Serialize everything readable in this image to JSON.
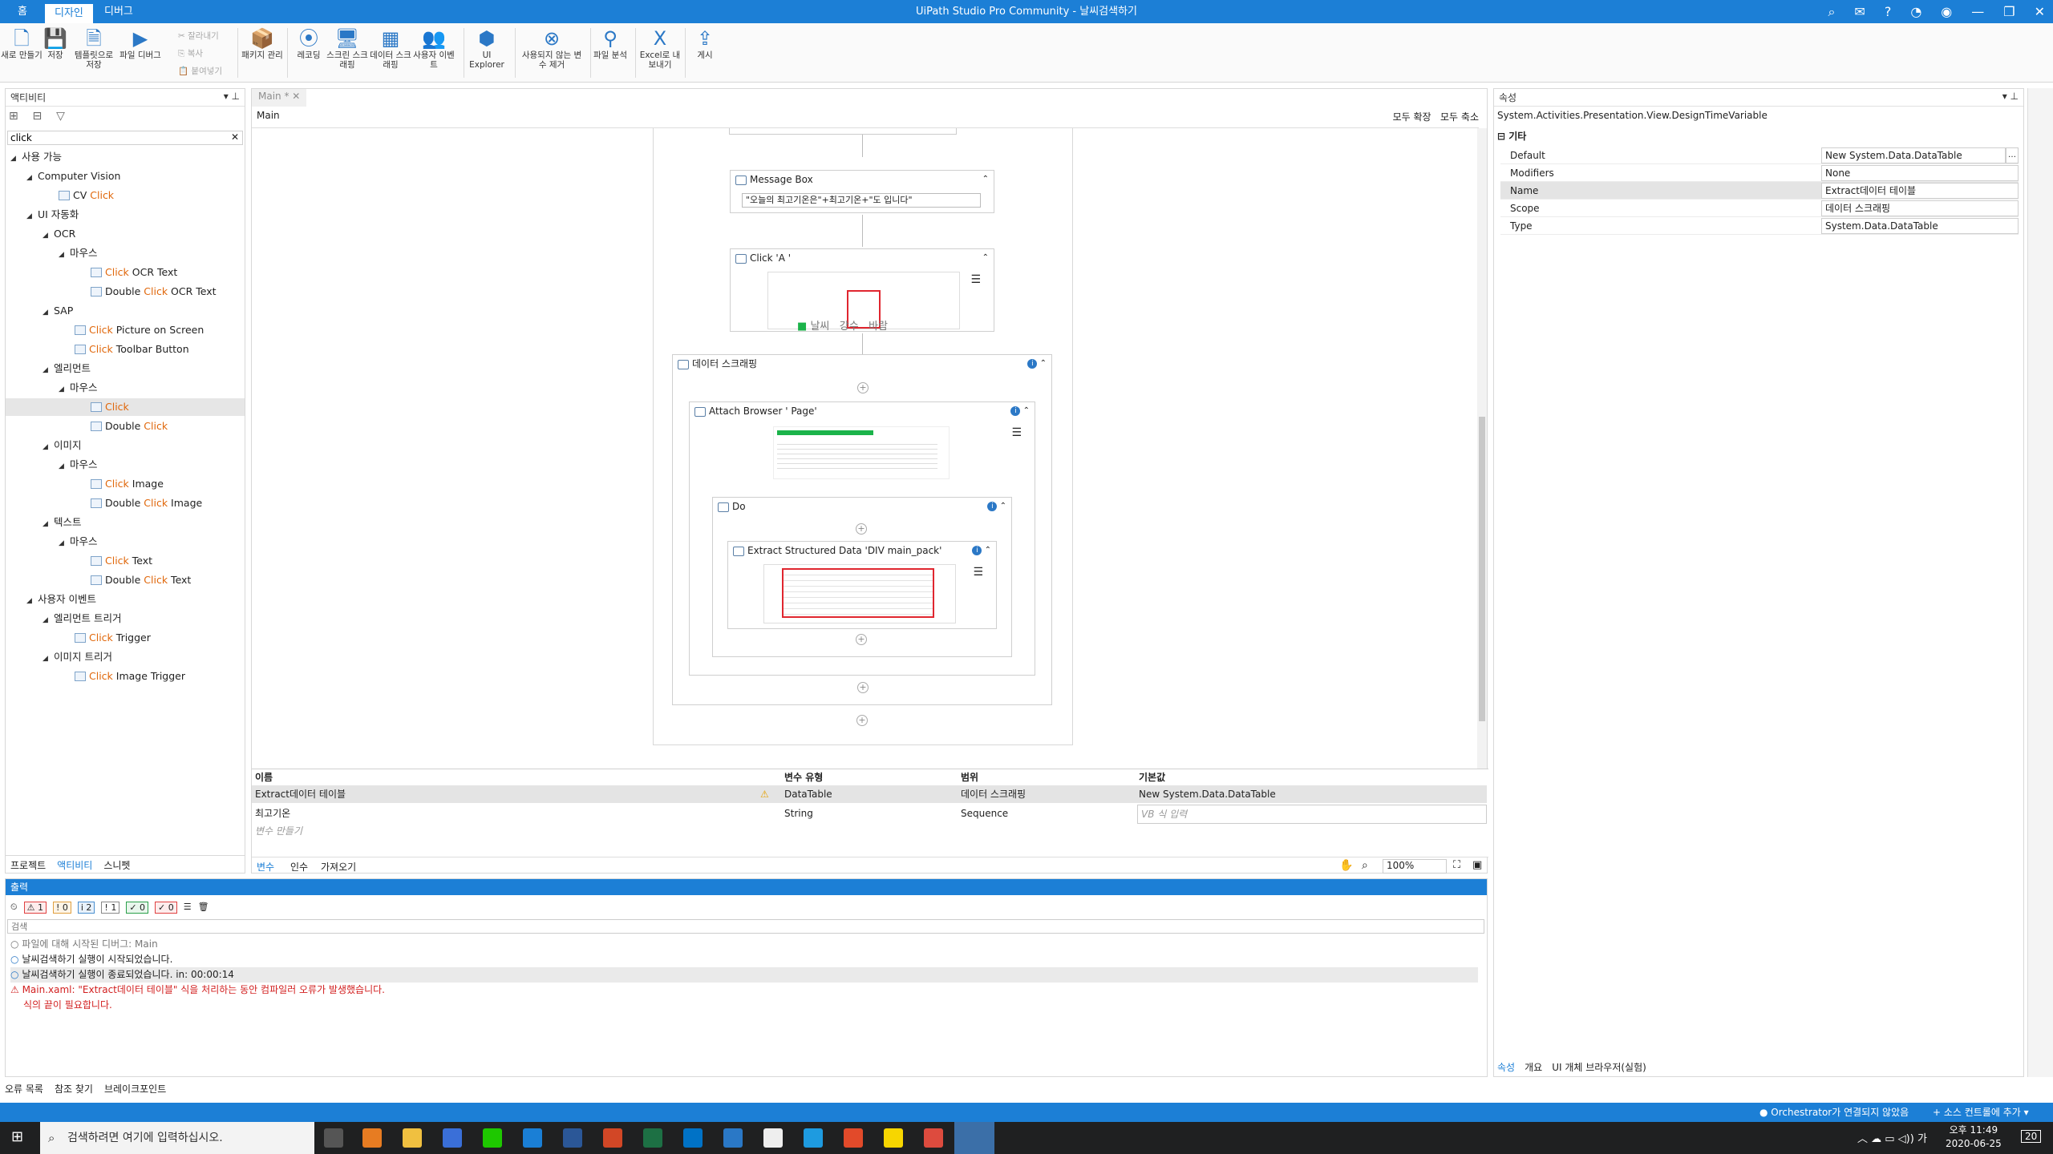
{
  "titlebar": {
    "tabs": [
      "홈",
      "디자인",
      "디버그"
    ],
    "title": "UiPath Studio Pro Community - 날씨검색하기"
  },
  "ribbon": {
    "new": "새로 만들기",
    "save": "저장",
    "save_template": "템플릿으로 저장",
    "debug_file": "파일 디버그",
    "cut": "잘라내기",
    "copy": "복사",
    "paste": "붙여넣기",
    "manage_packages": "패키지 관리",
    "recording": "레코딩",
    "screen_scraping": "스크린 스크래핑",
    "data_scraping": "데이터 스크래핑",
    "user_events": "사용자 이벤트",
    "ui_explorer": "UI Explorer",
    "remove_unused": "사용되지 않는 변수 제거",
    "analyze_file": "파일 분석",
    "export_excel": "Excel로 내보내기",
    "publish": "게시"
  },
  "activities": {
    "header": "액티비티",
    "search_value": "click",
    "tree": [
      {
        "label": "사용 가능",
        "level": 0,
        "arrow": "◢"
      },
      {
        "label": "Computer Vision",
        "level": 1,
        "arrow": "◢"
      },
      {
        "pre": "CV ",
        "hl": "Click",
        "post": "",
        "level": 3,
        "icon": true
      },
      {
        "label": "UI 자동화",
        "level": 1,
        "arrow": "◢"
      },
      {
        "label": "OCR",
        "level": 2,
        "arrow": "◢"
      },
      {
        "label": "마우스",
        "level": 3,
        "arrow": "◢"
      },
      {
        "pre": "",
        "hl": "Click",
        "post": " OCR Text",
        "level": 5,
        "icon": true
      },
      {
        "pre": "Double ",
        "hl": "Click",
        "post": " OCR Text",
        "level": 5,
        "icon": true
      },
      {
        "label": "SAP",
        "level": 2,
        "arrow": "◢"
      },
      {
        "pre": "",
        "hl": "Click",
        "post": " Picture on Screen",
        "level": 4,
        "icon": true
      },
      {
        "pre": "",
        "hl": "Click",
        "post": " Toolbar Button",
        "level": 4,
        "icon": true
      },
      {
        "label": "엘리먼트",
        "level": 2,
        "arrow": "◢"
      },
      {
        "label": "마우스",
        "level": 3,
        "arrow": "◢"
      },
      {
        "pre": "",
        "hl": "Click",
        "post": "",
        "level": 5,
        "icon": true,
        "selected": true
      },
      {
        "pre": "Double ",
        "hl": "Click",
        "post": "",
        "level": 5,
        "icon": true
      },
      {
        "label": "이미지",
        "level": 2,
        "arrow": "◢"
      },
      {
        "label": "마우스",
        "level": 3,
        "arrow": "◢"
      },
      {
        "pre": "",
        "hl": "Click",
        "post": " Image",
        "level": 5,
        "icon": true
      },
      {
        "pre": "Double ",
        "hl": "Click",
        "post": " Image",
        "level": 5,
        "icon": true
      },
      {
        "label": "텍스트",
        "level": 2,
        "arrow": "◢"
      },
      {
        "label": "마우스",
        "level": 3,
        "arrow": "◢"
      },
      {
        "pre": "",
        "hl": "Click",
        "post": " Text",
        "level": 5,
        "icon": true
      },
      {
        "pre": "Double ",
        "hl": "Click",
        "post": " Text",
        "level": 5,
        "icon": true
      },
      {
        "label": "사용자 이벤트",
        "level": 1,
        "arrow": "◢"
      },
      {
        "label": "엘리먼트 트리거",
        "level": 2,
        "arrow": "◢"
      },
      {
        "pre": "",
        "hl": "Click",
        "post": " Trigger",
        "level": 4,
        "icon": true
      },
      {
        "label": "이미지 트리거",
        "level": 2,
        "arrow": "◢"
      },
      {
        "pre": "",
        "hl": "Click",
        "post": " Image Trigger",
        "level": 4,
        "icon": true
      }
    ],
    "bottom_tabs": [
      "프로젝트",
      "액티비티",
      "스니펫"
    ]
  },
  "designer": {
    "doc_tab": "Main *",
    "breadcrumb": "Main",
    "expand_all": "모두 확장",
    "collapse_all": "모두 축소",
    "message_box": {
      "title": "Message Box",
      "text": "\"오늘의 최고기온은\"+최고기온+\"도 입니다\""
    },
    "click_a": {
      "title": "Click 'A '",
      "thumb_labels": [
        "날씨",
        "강수",
        "바람"
      ]
    },
    "data_scraping": {
      "title": "데이터 스크래핑"
    },
    "attach_browser": {
      "title": "Attach Browser '           Page'"
    },
    "do": {
      "title": "Do"
    },
    "extract": {
      "title": "Extract Structured Data 'DIV  main_pack'"
    },
    "variables": {
      "headers": [
        "이름",
        "변수 유형",
        "범위",
        "기본값"
      ],
      "rows": [
        [
          "Extract데이터 테이블",
          "DataTable",
          "데이터 스크래핑",
          "New System.Data.DataTable"
        ],
        [
          "최고기온",
          "String",
          "Sequence",
          "VB 식 입력"
        ]
      ],
      "create": "변수 만들기"
    },
    "bottom_tabs": [
      "변수",
      "인수",
      "가져오기"
    ],
    "zoom": "100%"
  },
  "output": {
    "header": "출력",
    "counts": [
      "1",
      "0",
      "2",
      "1",
      "0",
      "0"
    ],
    "search_placeholder": "검색",
    "lines": [
      "파일에 대해 시작된 디버그: Main",
      "날씨검색하기 실행이 시작되었습니다.",
      "날씨검색하기 실행이 종료되었습니다. in: 00:00:14",
      "Main.xaml: \"Extract데이터 테이블\" 식을 처리하는 동안 컴파일러 오류가 발생했습니다.",
      "식의 끝이 필요합니다."
    ]
  },
  "properties": {
    "header": "속성",
    "type_name": "System.Activities.Presentation.View.DesignTimeVariable",
    "section": "기타",
    "rows": [
      {
        "key": "Default",
        "value": "New System.Data.DataTable"
      },
      {
        "key": "Modifiers",
        "value": "None"
      },
      {
        "key": "Name",
        "value": "Extract데이터 테이블"
      },
      {
        "key": "Scope",
        "value": "데이터 스크래핑"
      },
      {
        "key": "Type",
        "value": "System.Data.DataTable"
      }
    ],
    "bottom_tabs": [
      "속성",
      "개요",
      "UI 개체 브라우저(실험)"
    ]
  },
  "bottom_left_tabs": [
    "오류 목록",
    "참조 찾기",
    "브레이크포인트"
  ],
  "statusbar": {
    "orchestrator": "Orchestrator가 연결되지 않았음",
    "source_control": "+ 소스 컨트롤에 추가 ▾"
  },
  "taskbar": {
    "search_placeholder": "검색하려면 여기에 입력하십시오.",
    "time": "오후 11:49",
    "date": "2020-06-25",
    "notif_count": "20"
  }
}
